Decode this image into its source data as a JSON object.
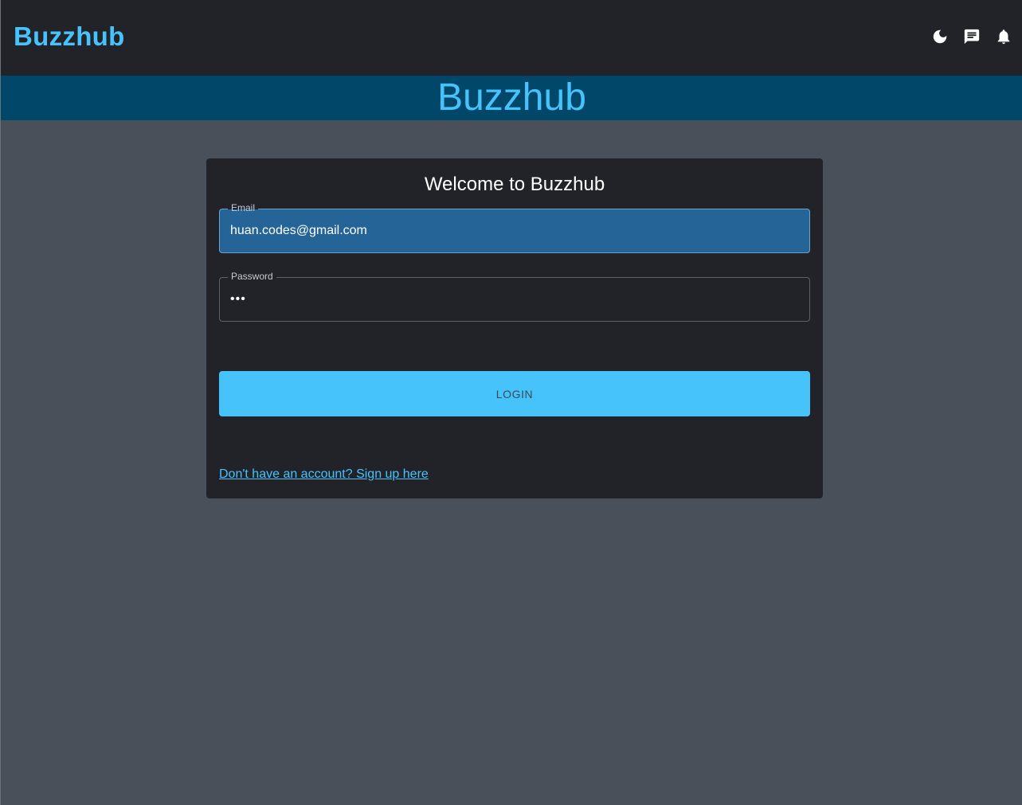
{
  "header": {
    "brand": "Buzzhub",
    "icons": [
      "moon-icon",
      "chat-icon",
      "bell-icon"
    ]
  },
  "banner": {
    "title": "Buzzhub"
  },
  "login": {
    "title": "Welcome to Buzzhub",
    "email_label": "Email",
    "email_value": "huan.codes@gmail.com",
    "password_label": "Password",
    "password_value": "abc",
    "login_button": "LOGIN",
    "signup_link": "Don't have an account? Sign up here"
  },
  "colors": {
    "accent": "#47c3fc",
    "topbar": "#212329",
    "banner": "#00476a",
    "background": "#4a5059",
    "email_field_bg": "#256496"
  }
}
